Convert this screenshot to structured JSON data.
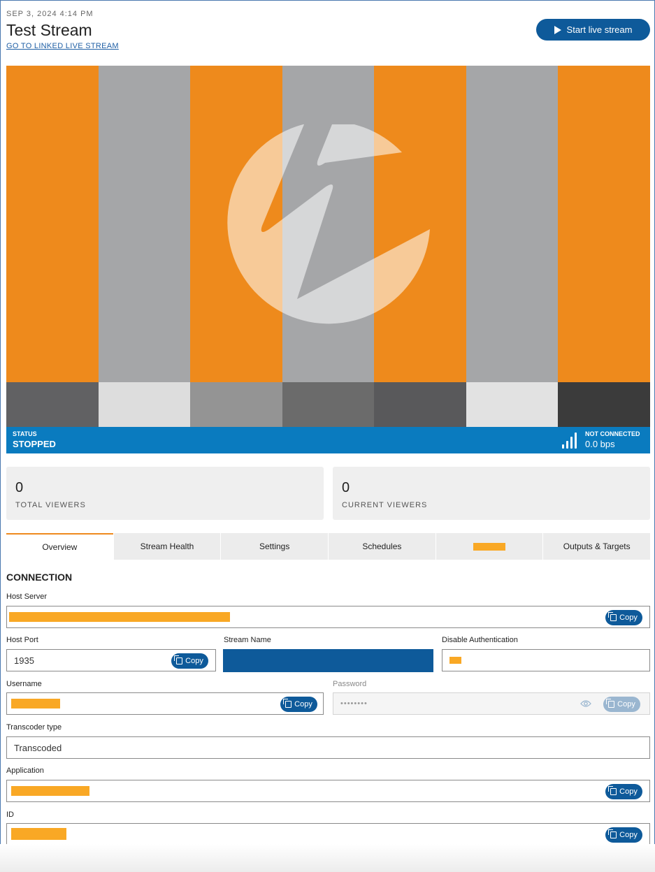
{
  "header": {
    "date": "SEP 3, 2024 4:14 PM",
    "title": "Test Stream",
    "linked_link": "GO TO LINKED LIVE STREAM",
    "start_button": "Start live stream"
  },
  "preview": {
    "bar_colors": [
      "#ee8a1c",
      "#a5a6a8",
      "#ee8a1c",
      "#a5a6a8",
      "#ee8a1c",
      "#a5a6a8",
      "#ee8a1c"
    ],
    "lower_bar_colors": [
      "#616163",
      "#dddddd",
      "#949494",
      "#6b6b6b",
      "#59595b",
      "#e2e2e2",
      "#3b3b3b"
    ],
    "logo_icon": "wowza-logo-icon"
  },
  "status": {
    "status_label": "STATUS",
    "status_value": "STOPPED",
    "connection_label": "NOT CONNECTED",
    "connection_value": "0.0 bps",
    "color": "#0a7bbf"
  },
  "stats": {
    "total_viewers_value": "0",
    "total_viewers_label": "TOTAL VIEWERS",
    "current_viewers_value": "0",
    "current_viewers_label": "CURRENT VIEWERS"
  },
  "tabs": [
    {
      "label": "Overview",
      "active": true
    },
    {
      "label": "Stream Health"
    },
    {
      "label": "Settings"
    },
    {
      "label": "Schedules"
    },
    {
      "label": ""
    },
    {
      "label": "Outputs & Targets"
    }
  ],
  "connection": {
    "section_title": "CONNECTION",
    "host_server_label": "Host Server",
    "host_port_label": "Host Port",
    "host_port_value": "1935",
    "stream_name_label": "Stream Name",
    "disable_auth_label": "Disable Authentication",
    "username_label": "Username",
    "password_label": "Password",
    "password_value": "••••••••",
    "transcoder_type_label": "Transcoder type",
    "transcoder_type_value": "Transcoded",
    "application_label": "Application",
    "id_label": "ID",
    "copy_label": "Copy"
  },
  "colors": {
    "accent": "#0e5a9a",
    "redaction": "#f9a825",
    "tab_active_border": "#ef8a1e"
  }
}
